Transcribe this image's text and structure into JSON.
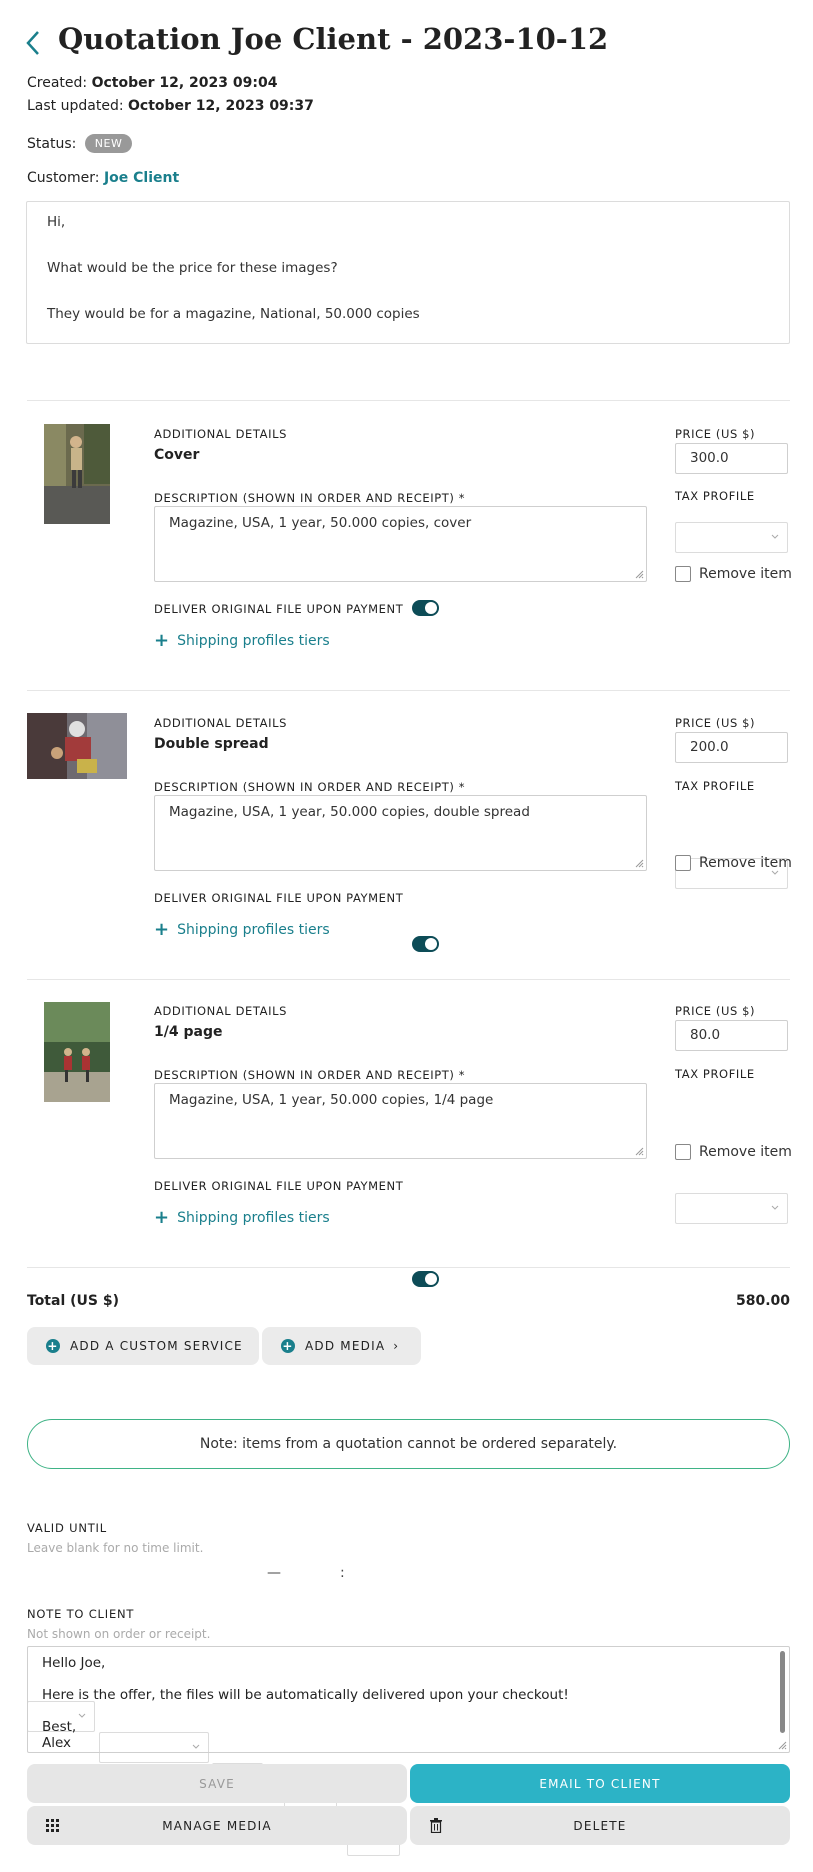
{
  "header": {
    "title": "Quotation Joe Client - 2023-10-12",
    "created_label": "Created:",
    "created_value": "October 12, 2023 09:04",
    "updated_label": "Last updated:",
    "updated_value": "October 12, 2023 09:37",
    "status_label": "Status:",
    "status_value": "NEW",
    "customer_label": "Customer:",
    "customer_value": "Joe Client"
  },
  "message": {
    "lines": [
      "Hi,",
      "",
      "What would be the price for these images?",
      "",
      "They would be for a magazine, National, 50.000 copies"
    ]
  },
  "labels": {
    "additional_details": "ADDITIONAL DETAILS",
    "description": "DESCRIPTION (SHOWN IN ORDER AND RECEIPT) *",
    "deliver": "DELIVER ORIGINAL FILE UPON PAYMENT",
    "shipping": "Shipping profiles tiers",
    "price": "PRICE (US $)",
    "tax": "TAX PROFILE",
    "remove": "Remove item"
  },
  "items": [
    {
      "name": "Cover",
      "description": "Magazine, USA, 1 year, 50.000 copies, cover",
      "price": "300.0",
      "deliver_on": true
    },
    {
      "name": "Double spread",
      "description": "Magazine, USA, 1 year, 50.000 copies, double spread",
      "price": "200.0",
      "deliver_on": true
    },
    {
      "name": "1/4 page",
      "description": "Magazine, USA, 1 year, 50.000 copies, 1/4 page",
      "price": "80.0",
      "deliver_on": true
    }
  ],
  "totals": {
    "label": "Total (US $)",
    "value": "580.00"
  },
  "actions": {
    "add_service": "ADD A CUSTOM SERVICE",
    "add_media": "ADD MEDIA",
    "add_media_arrow": "›"
  },
  "note_banner": "Note: items from a quotation cannot be ordered separately.",
  "valid_until": {
    "label": "VALID UNTIL",
    "hint": "Leave blank for no time limit.",
    "dash": "—",
    "colon": ":"
  },
  "note_to_client": {
    "label": "NOTE TO CLIENT",
    "hint": "Not shown on order or receipt.",
    "lines": [
      "Hello Joe,",
      "",
      "Here is the offer, the files will be automatically delivered upon your checkout!",
      "",
      "Best,",
      "Alex"
    ]
  },
  "footer": {
    "save": "SAVE",
    "email": "EMAIL TO CLIENT",
    "manage_media": "MANAGE MEDIA",
    "delete": "DELETE"
  },
  "colors": {
    "accent": "#1a7f8c",
    "email_button": "#2cb3c6",
    "toggle_on": "#0d4c57",
    "note_border": "#3fb386"
  }
}
